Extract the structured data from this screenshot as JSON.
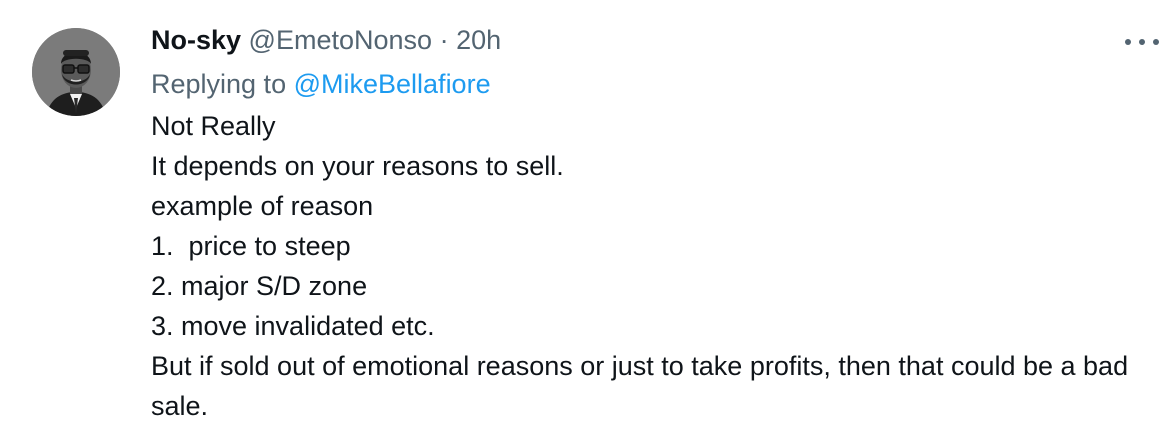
{
  "author": {
    "name": "No-sky",
    "handle": "@EmetoNonso",
    "separator": "·",
    "time": "20h"
  },
  "reply": {
    "prefix": "Replying to",
    "mention": "@MikeBellafiore"
  },
  "body": {
    "lines": [
      "Not Really",
      "It depends on your reasons to sell.",
      "example of reason",
      "1.  price to steep",
      "2. major S/D zone",
      "3. move invalidated etc.",
      "But if sold out of emotional reasons or just to take profits, then that could be a bad sale."
    ]
  },
  "icons": {
    "more": "more-horizontal-icon",
    "avatar": "user-avatar"
  },
  "colors": {
    "text": "#0f1419",
    "muted": "#536471",
    "link": "#1d9bf0",
    "avatar_bg": "#7b7b7b"
  }
}
